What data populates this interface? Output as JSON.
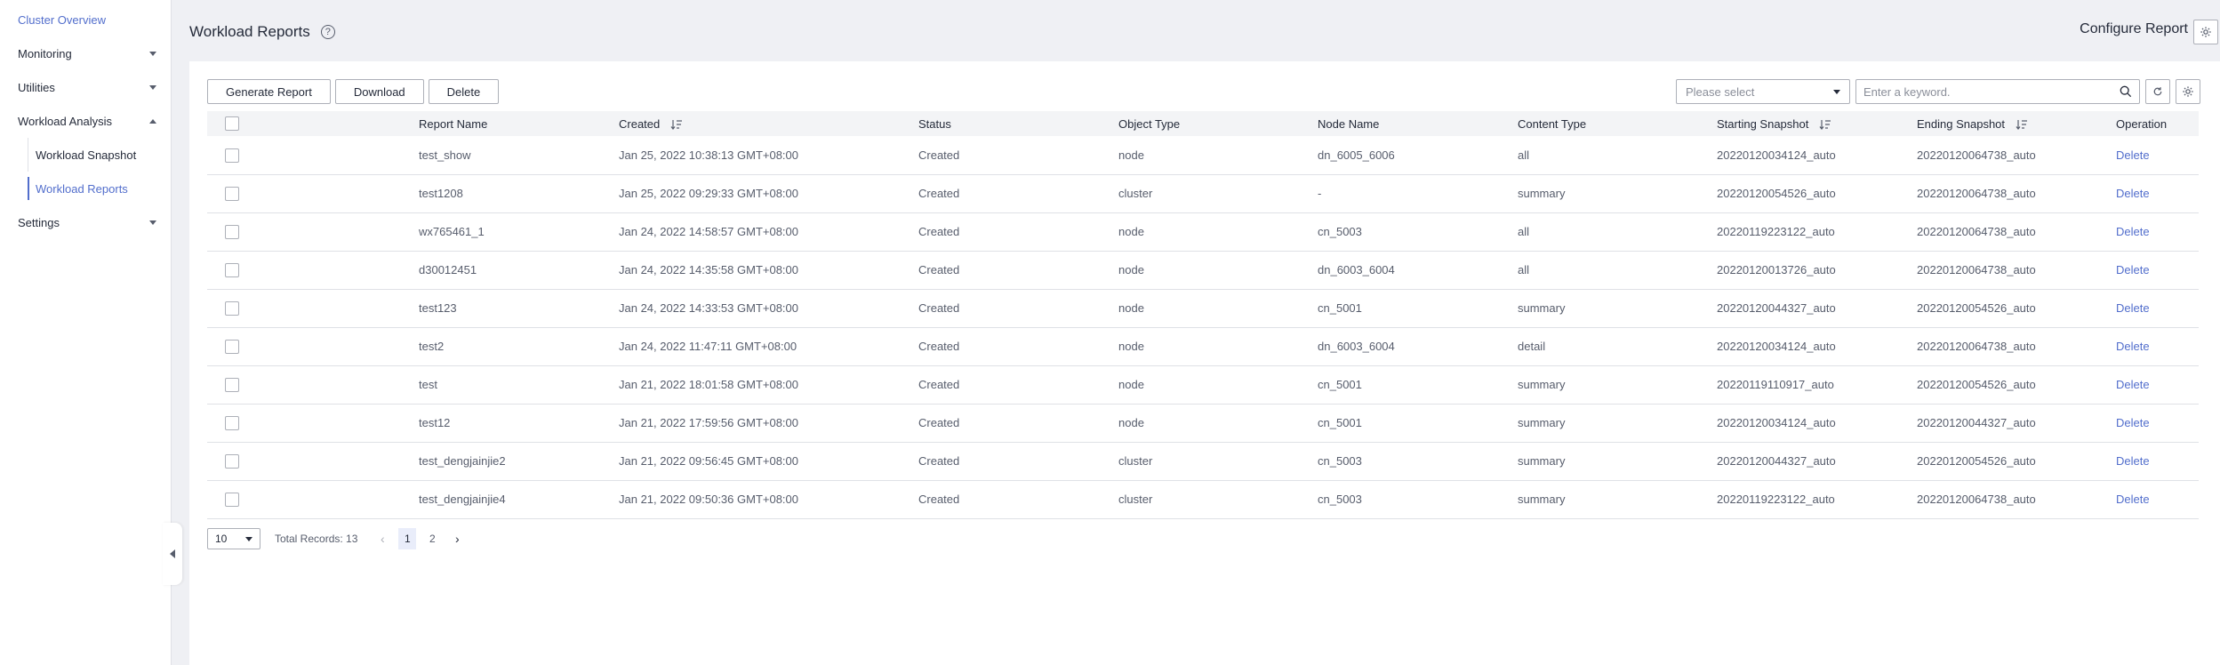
{
  "sidebar": {
    "items": [
      {
        "label": "Cluster Overview"
      },
      {
        "label": "Monitoring"
      },
      {
        "label": "Utilities"
      },
      {
        "label": "Workload Analysis"
      },
      {
        "label": "Workload Snapshot"
      },
      {
        "label": "Workload Reports"
      },
      {
        "label": "Settings"
      }
    ]
  },
  "header": {
    "title": "Workload Reports",
    "configure_label": "Configure Report"
  },
  "toolbar": {
    "generate_label": "Generate Report",
    "download_label": "Download",
    "delete_label": "Delete"
  },
  "filter": {
    "select_placeholder": "Please select",
    "search_placeholder": "Enter a keyword."
  },
  "table": {
    "columns": [
      "Report Name",
      "Created",
      "Status",
      "Object Type",
      "Node Name",
      "Content Type",
      "Starting Snapshot",
      "Ending Snapshot",
      "Operation"
    ],
    "rows": [
      [
        "test_show",
        "Jan 25, 2022 10:38:13 GMT+08:00",
        "Created",
        "node",
        "dn_6005_6006",
        "all",
        "20220120034124_auto",
        "20220120064738_auto",
        "Delete"
      ],
      [
        "test1208",
        "Jan 25, 2022 09:29:33 GMT+08:00",
        "Created",
        "cluster",
        "-",
        "summary",
        "20220120054526_auto",
        "20220120064738_auto",
        "Delete"
      ],
      [
        "wx765461_1",
        "Jan 24, 2022 14:58:57 GMT+08:00",
        "Created",
        "node",
        "cn_5003",
        "all",
        "20220119223122_auto",
        "20220120064738_auto",
        "Delete"
      ],
      [
        "d30012451",
        "Jan 24, 2022 14:35:58 GMT+08:00",
        "Created",
        "node",
        "dn_6003_6004",
        "all",
        "20220120013726_auto",
        "20220120064738_auto",
        "Delete"
      ],
      [
        "test123",
        "Jan 24, 2022 14:33:53 GMT+08:00",
        "Created",
        "node",
        "cn_5001",
        "summary",
        "20220120044327_auto",
        "20220120054526_auto",
        "Delete"
      ],
      [
        "test2",
        "Jan 24, 2022 11:47:11 GMT+08:00",
        "Created",
        "node",
        "dn_6003_6004",
        "detail",
        "20220120034124_auto",
        "20220120064738_auto",
        "Delete"
      ],
      [
        "test",
        "Jan 21, 2022 18:01:58 GMT+08:00",
        "Created",
        "node",
        "cn_5001",
        "summary",
        "20220119110917_auto",
        "20220120054526_auto",
        "Delete"
      ],
      [
        "test12",
        "Jan 21, 2022 17:59:56 GMT+08:00",
        "Created",
        "node",
        "cn_5001",
        "summary",
        "20220120034124_auto",
        "20220120044327_auto",
        "Delete"
      ],
      [
        "test_dengjainjie2",
        "Jan 21, 2022 09:56:45 GMT+08:00",
        "Created",
        "cluster",
        "cn_5003",
        "summary",
        "20220120044327_auto",
        "20220120054526_auto",
        "Delete"
      ],
      [
        "test_dengjainjie4",
        "Jan 21, 2022 09:50:36 GMT+08:00",
        "Created",
        "cluster",
        "cn_5003",
        "summary",
        "20220119223122_auto",
        "20220120064738_auto",
        "Delete"
      ]
    ]
  },
  "pagination": {
    "page_size": "10",
    "total": "Total Records: 13",
    "pages": [
      "1",
      "2"
    ]
  },
  "colors": {
    "accent": "#526ecc",
    "background": "#eff0f4"
  }
}
